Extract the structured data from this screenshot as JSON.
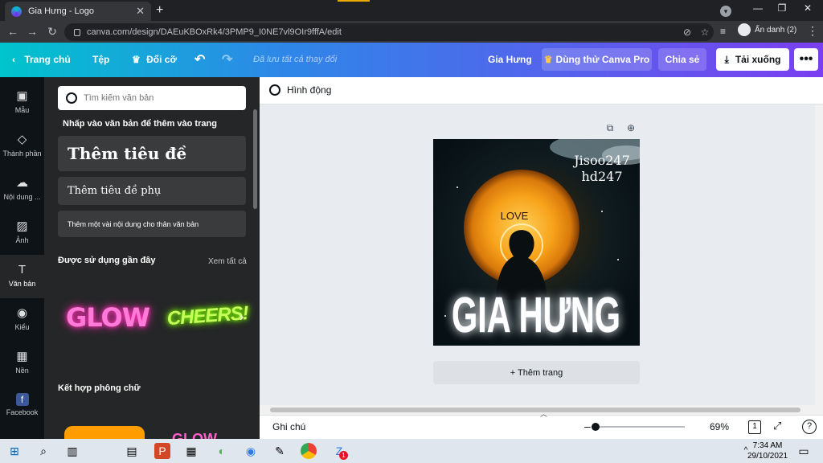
{
  "browser": {
    "tab_title": "Gia Hưng - Logo",
    "new_tab": "+",
    "url": "canva.com/design/DAEuKBOxRk4/3PMP9_I0NE7vl9OIr9fffA/edit",
    "profile_label": "Ẩn danh (2)"
  },
  "header": {
    "home": "Trang chủ",
    "file": "Tệp",
    "resize": "Đổi cỡ",
    "saved_status": "Đã lưu tất cả thay đổi",
    "design_title": "Gia Hưng",
    "try_pro": "Dùng thử Canva Pro",
    "share": "Chia sẻ",
    "download": "Tải xuống"
  },
  "rail": {
    "items": [
      {
        "label": "Mẫu",
        "icon": "templates-icon"
      },
      {
        "label": "Thành phần",
        "icon": "elements-icon"
      },
      {
        "label": "Nội dung ...",
        "icon": "uploads-icon"
      },
      {
        "label": "Ảnh",
        "icon": "photos-icon"
      },
      {
        "label": "Văn bản",
        "icon": "text-icon"
      },
      {
        "label": "Kiểu",
        "icon": "styles-icon"
      },
      {
        "label": "Nền",
        "icon": "background-icon"
      },
      {
        "label": "Facebook",
        "icon": "facebook-icon"
      }
    ]
  },
  "panel": {
    "search_placeholder": "Tìm kiếm văn bản",
    "click_hint": "Nhấp vào văn bản để thêm vào trang",
    "add_heading": "Thêm tiêu đề",
    "add_subheading": "Thêm tiêu đề phụ",
    "add_body": "Thêm một vài nội dung cho thân văn bản",
    "recent_title": "Được sử dụng gần đây",
    "see_all": "Xem tất cả",
    "recent_items": [
      "GLOW",
      "CHEERS!"
    ],
    "combo_title": "Kết hợp phông chữ",
    "combo_partial": "GLOW"
  },
  "editor": {
    "animate": "Hình động",
    "design_text": {
      "top_line1": "Jisoo247",
      "top_line2": "hd247",
      "love": "LOVE",
      "main": "GIA HƯNG"
    },
    "add_page": "+ Thêm trang"
  },
  "footer": {
    "notes": "Ghi chú",
    "zoom": "69%",
    "zoom_level": 0.0,
    "page_count": "1",
    "help": "?"
  },
  "taskbar": {
    "time": "7:34 AM",
    "date": "29/10/2021",
    "badge": "1"
  },
  "colors": {
    "brand_teal": "#00c4cc",
    "brand_purple": "#7a3ff0",
    "rail_bg": "#0e1318",
    "panel_bg": "#252627"
  }
}
